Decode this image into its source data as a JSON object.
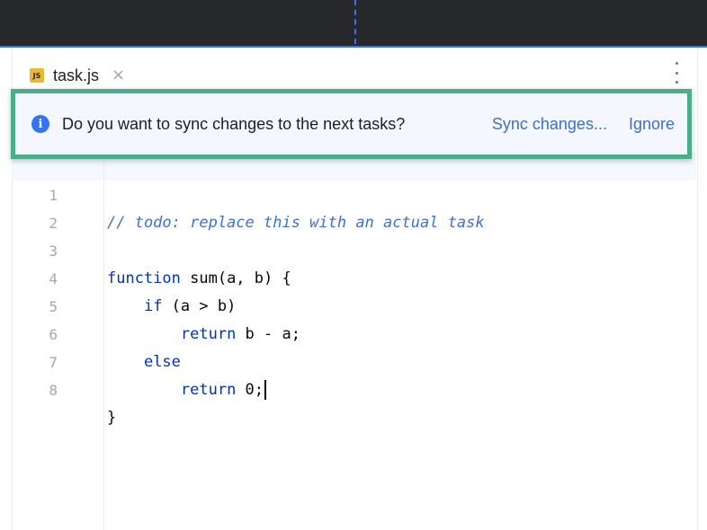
{
  "tab": {
    "icon": "javascript-file-icon",
    "icon_text": "JS",
    "filename": "task.js",
    "close_icon": "close-icon"
  },
  "toolbar": {
    "more_icon": "more-vertical-icon"
  },
  "banner": {
    "icon": "info-icon",
    "icon_text": "i",
    "message": "Do you want to sync changes to the next tasks?",
    "sync_label": "Sync changes...",
    "ignore_label": "Ignore"
  },
  "editor": {
    "lines": [
      {
        "number": "1",
        "text": "// todo: replace this with an actual task"
      },
      {
        "number": "2",
        "text": ""
      },
      {
        "number": "3",
        "text": "function sum(a, b) {"
      },
      {
        "number": "4",
        "text": "    if (a > b)"
      },
      {
        "number": "5",
        "text": "        return b - a;"
      },
      {
        "number": "6",
        "text": "    else"
      },
      {
        "number": "7",
        "text": "        return 0;"
      },
      {
        "number": "8",
        "text": "}"
      }
    ]
  },
  "colors": {
    "accent": "#3574f0",
    "banner_border": "#4bad8a",
    "keyword": "#0033b3",
    "comment": "#3f71c8",
    "link": "#3d6fc7"
  }
}
